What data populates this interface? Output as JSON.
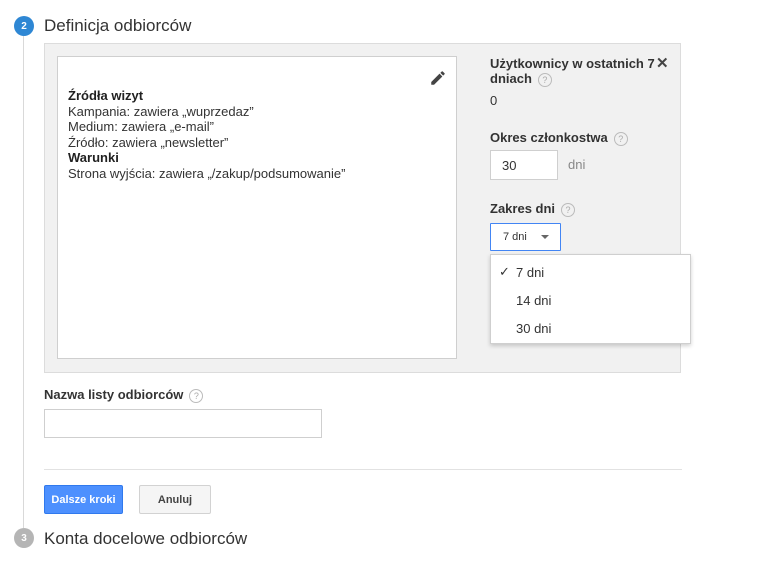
{
  "step2": {
    "number": "2",
    "title": "Definicja odbiorców"
  },
  "step3": {
    "number": "3",
    "title": "Konta docelowe odbiorców"
  },
  "definition": {
    "sources_heading": "Źródła wizyt",
    "sources": [
      "Kampania: zawiera „wuprzedaz”",
      "Medium: zawiera „e-mail”",
      "Źródło: zawiera „newsletter”"
    ],
    "conditions_heading": "Warunki",
    "conditions": [
      "Strona wyjścia: zawiera „/zakup/podsumowanie”"
    ]
  },
  "users": {
    "label_line1": "Użytkownicy w ostatnich 7",
    "label_line2": "dniach",
    "help": "?",
    "value": "0"
  },
  "membership": {
    "label": "Okres członkostwa",
    "help": "?",
    "value": "30",
    "unit": "dni"
  },
  "date_range": {
    "label": "Zakres dni",
    "help": "?",
    "selected": "7 dni",
    "options": [
      "7 dni",
      "14 dni",
      "30 dni"
    ],
    "checkmark": "✓"
  },
  "close_glyph": "✕",
  "list_name": {
    "label": "Nazwa listy odbiorców",
    "help": "?",
    "value": ""
  },
  "buttons": {
    "next": "Dalsze kroki",
    "cancel": "Anuluj"
  },
  "colors": {
    "accent": "#4d90fe",
    "step_active": "#2e87d4",
    "step_inactive": "#b5b5b5",
    "dropdown_border": "#4285f4"
  }
}
